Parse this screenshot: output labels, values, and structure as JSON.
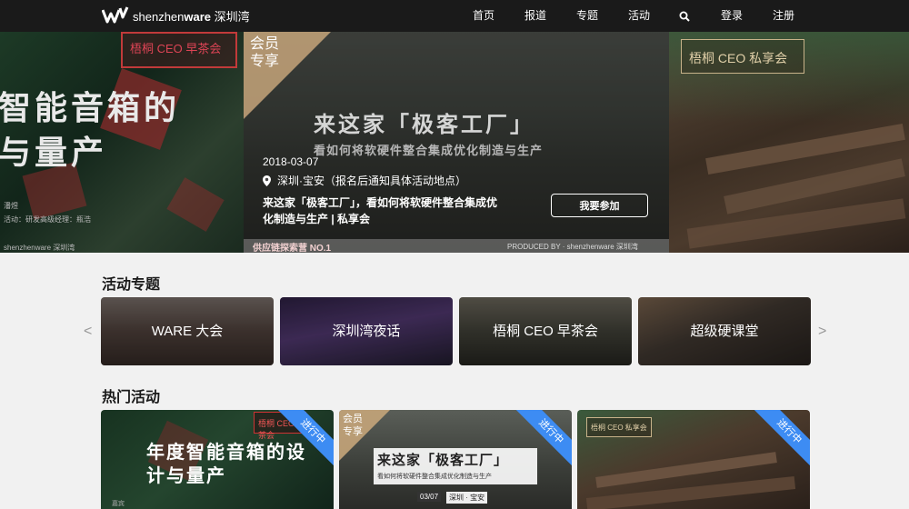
{
  "header": {
    "logo_text": "shenzhenware",
    "logo_text_bold": "ware",
    "logo_cn": "深圳湾",
    "nav": [
      "首页",
      "报道",
      "专题",
      "活动"
    ],
    "login": "登录",
    "register": "注册",
    "search_icon": "search-icon"
  },
  "hero": {
    "left": {
      "line1": "智能音箱的",
      "line2": "与量产",
      "badge": "梧桐 CEO 早茶会",
      "small1": "潘煜",
      "small2": "活动：研发高级经理：瓶浩",
      "logo_small": "shenzhenware 深圳湾"
    },
    "mid": {
      "member": "会员 专享",
      "bg_title": "来这家「极客工厂」",
      "bg_sub": "看如何将软硬件整合集成优化制造与生产",
      "date": "2018-03-07",
      "location": "深圳·宝安（报名后通知具体活动地点）",
      "event_title": "来这家「极客工厂」，看如何将软硬件整合集成优化制造与生产 | 私享会",
      "join": "我要参加",
      "bottom_left": "供应链探索营 NO.1",
      "bottom_right": "PRODUCED BY · shenzhenware 深圳湾"
    },
    "right": {
      "badge": "梧桐 CEO 私享会"
    }
  },
  "topics": {
    "title": "活动专题",
    "prev": "<",
    "next": ">",
    "items": [
      {
        "label": "WARE 大会",
        "bg": "#5a4a44"
      },
      {
        "label": "深圳湾夜话",
        "bg": "#3a2a4a"
      },
      {
        "label": "梧桐 CEO 早茶会",
        "bg": "#4a4a40"
      },
      {
        "label": "超级硬课堂",
        "bg": "#4a4038"
      }
    ]
  },
  "hot": {
    "title": "热门活动",
    "cards": [
      {
        "title": "年度智能音箱的设计与量产",
        "status": "进行中",
        "badge": "梧桐 CEO 早茶会",
        "small": "嘉宾"
      },
      {
        "title": "来这家「极客工厂」",
        "sub": "看如何将软硬件整合集成优化制造与生产",
        "status": "进行中",
        "member": "会员 专享",
        "date": "03/07",
        "place": "深圳 · 宝安"
      },
      {
        "title": "",
        "status": "进行中",
        "badge": "梧桐 CEO 私享会"
      }
    ]
  },
  "colors": {
    "topbar": "#1a1a1a",
    "ribbon": "#3d8cf3",
    "member": "#c5a57a"
  }
}
